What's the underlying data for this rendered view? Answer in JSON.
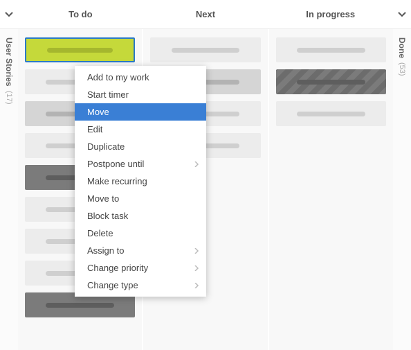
{
  "columns": [
    {
      "id": "todo",
      "label": "To do"
    },
    {
      "id": "next",
      "label": "Next"
    },
    {
      "id": "inprogress",
      "label": "In progress"
    }
  ],
  "collapsed_column": {
    "label": "Done",
    "count": "(53)"
  },
  "swimlane": {
    "label": "User Stories",
    "count": "(17)"
  },
  "cards": {
    "todo": [
      {
        "variant": "selected"
      },
      {
        "variant": "light"
      },
      {
        "variant": "mid"
      },
      {
        "variant": "light"
      },
      {
        "variant": "dark"
      },
      {
        "variant": "light"
      },
      {
        "variant": "light"
      },
      {
        "variant": "light"
      },
      {
        "variant": "dark"
      }
    ],
    "next": [
      {
        "variant": "light"
      },
      {
        "variant": "mid"
      },
      {
        "variant": "light"
      },
      {
        "variant": "light"
      }
    ],
    "inprogress": [
      {
        "variant": "light"
      },
      {
        "variant": "striped"
      },
      {
        "variant": "light"
      }
    ]
  },
  "context_menu": {
    "items": [
      {
        "label": "Add to my work",
        "submenu": false,
        "highlighted": false
      },
      {
        "label": "Start timer",
        "submenu": false,
        "highlighted": false
      },
      {
        "label": "Move",
        "submenu": false,
        "highlighted": true
      },
      {
        "label": "Edit",
        "submenu": false,
        "highlighted": false
      },
      {
        "label": "Duplicate",
        "submenu": false,
        "highlighted": false
      },
      {
        "label": "Postpone until",
        "submenu": true,
        "highlighted": false
      },
      {
        "label": "Make recurring",
        "submenu": false,
        "highlighted": false
      },
      {
        "label": "Move to",
        "submenu": false,
        "highlighted": false
      },
      {
        "label": "Block task",
        "submenu": false,
        "highlighted": false
      },
      {
        "label": "Delete",
        "submenu": false,
        "highlighted": false
      },
      {
        "label": "Assign to",
        "submenu": true,
        "highlighted": false
      },
      {
        "label": "Change priority",
        "submenu": true,
        "highlighted": false
      },
      {
        "label": "Change type",
        "submenu": true,
        "highlighted": false
      }
    ]
  }
}
